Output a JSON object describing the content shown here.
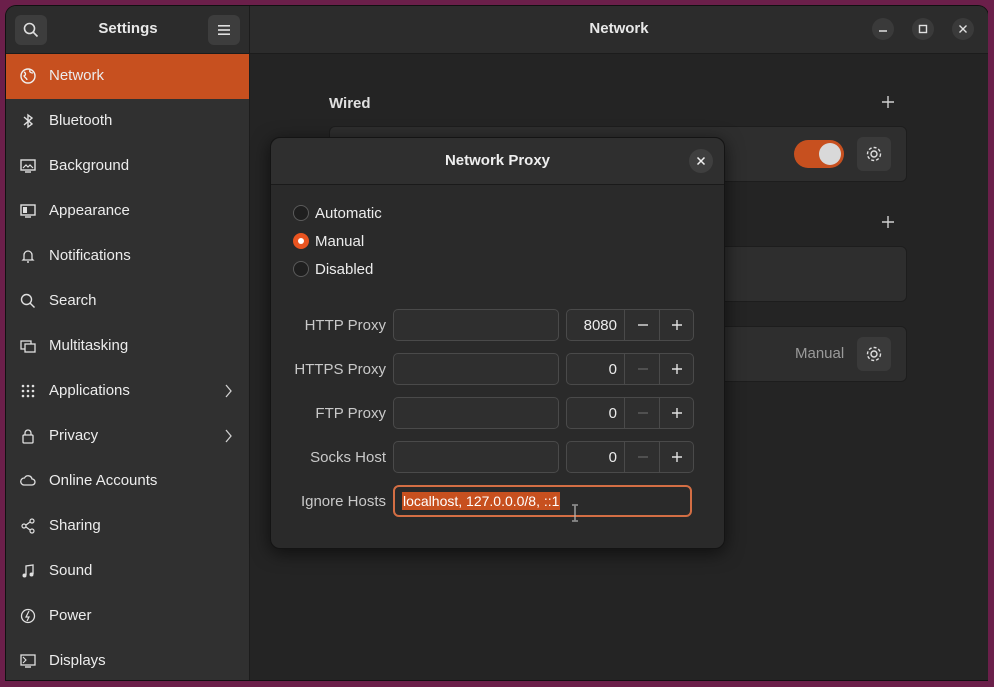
{
  "sidebar": {
    "title": "Settings",
    "items": [
      {
        "label": "Network",
        "icon": "globe-icon",
        "active": true,
        "chevron": false
      },
      {
        "label": "Bluetooth",
        "icon": "bluetooth-icon",
        "active": false,
        "chevron": false
      },
      {
        "label": "Background",
        "icon": "background-icon",
        "active": false,
        "chevron": false
      },
      {
        "label": "Appearance",
        "icon": "appearance-icon",
        "active": false,
        "chevron": false
      },
      {
        "label": "Notifications",
        "icon": "bell-icon",
        "active": false,
        "chevron": false
      },
      {
        "label": "Search",
        "icon": "search-icon",
        "active": false,
        "chevron": false
      },
      {
        "label": "Multitasking",
        "icon": "multitasking-icon",
        "active": false,
        "chevron": false
      },
      {
        "label": "Applications",
        "icon": "grid-icon",
        "active": false,
        "chevron": true
      },
      {
        "label": "Privacy",
        "icon": "lock-icon",
        "active": false,
        "chevron": true
      },
      {
        "label": "Online Accounts",
        "icon": "cloud-icon",
        "active": false,
        "chevron": false
      },
      {
        "label": "Sharing",
        "icon": "share-icon",
        "active": false,
        "chevron": false
      },
      {
        "label": "Sound",
        "icon": "music-note-icon",
        "active": false,
        "chevron": false
      },
      {
        "label": "Power",
        "icon": "power-icon",
        "active": false,
        "chevron": false
      },
      {
        "label": "Displays",
        "icon": "display-icon",
        "active": false,
        "chevron": false
      }
    ]
  },
  "main": {
    "title": "Network",
    "wired_title": "Wired",
    "proxy_status": "Manual"
  },
  "dialog": {
    "title": "Network Proxy",
    "modes": [
      {
        "label": "Automatic",
        "selected": false
      },
      {
        "label": "Manual",
        "selected": true
      },
      {
        "label": "Disabled",
        "selected": false
      }
    ],
    "proxies": [
      {
        "label": "HTTP Proxy",
        "host": "",
        "port": "8080",
        "minus_enabled": true
      },
      {
        "label": "HTTPS Proxy",
        "host": "",
        "port": "0",
        "minus_enabled": false
      },
      {
        "label": "FTP Proxy",
        "host": "",
        "port": "0",
        "minus_enabled": false
      },
      {
        "label": "Socks Host",
        "host": "",
        "port": "0",
        "minus_enabled": false
      }
    ],
    "ignore_label": "Ignore Hosts",
    "ignore_value": "localhost, 127.0.0.0/8, ::1"
  },
  "colors": {
    "accent": "#c7501f",
    "window_bg": "#242424",
    "sidebar_bg": "#303030",
    "desktop_bg": "#6b1f4a"
  }
}
